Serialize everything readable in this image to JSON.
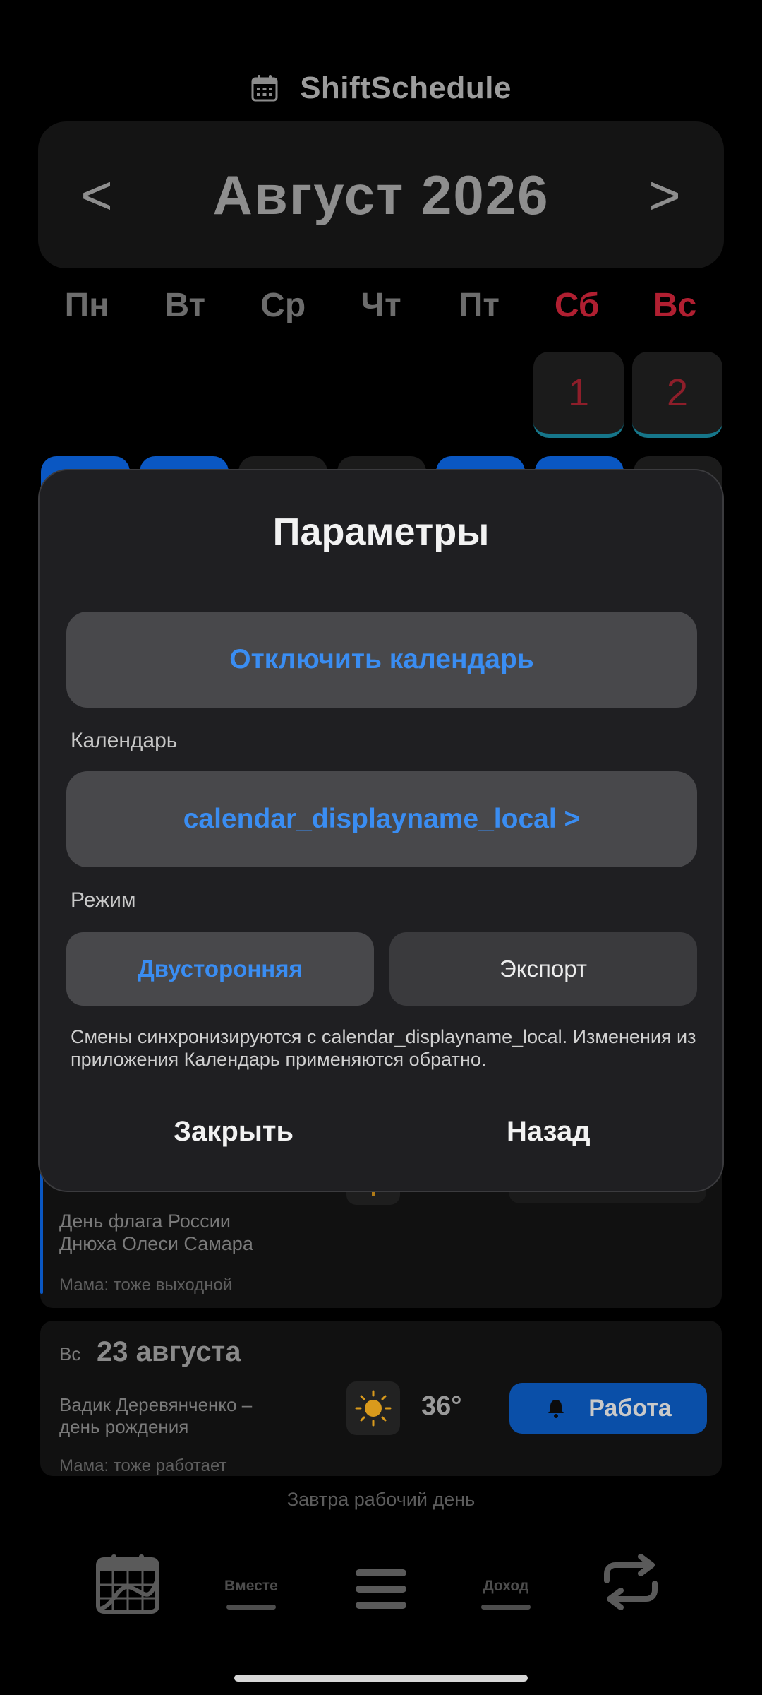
{
  "header": {
    "app_name": "ShiftSchedule"
  },
  "month_nav": {
    "prev": "<",
    "title": "Август 2026",
    "next": ">"
  },
  "weekdays": [
    "Пн",
    "Вт",
    "Ср",
    "Чт",
    "Пт",
    "Сб",
    "Вс"
  ],
  "calendar": {
    "day_1": "1",
    "day_2": "2"
  },
  "list": {
    "card1": {
      "holiday": "День флага России",
      "birthday": "Днюха Олеси Самара",
      "note": "Мама: тоже выходной"
    },
    "card2": {
      "weekday": "Вс",
      "date": "23 августа",
      "event": "Вадик Деревянченко –\nдень рождения",
      "temp": "36°",
      "shift_button": "Работа",
      "note": "Мама: тоже работает"
    }
  },
  "modal": {
    "title": "Параметры",
    "disable_button": "Отключить календарь",
    "calendar_label": "Календарь",
    "calendar_select": "calendar_displayname_local >",
    "mode_label": "Режим",
    "mode_two_way": "Двусторонняя",
    "mode_export": "Экспорт",
    "helper": "Смены синхронизируются с calendar_displayname_local. Изменения из приложения Календарь применяются обратно.",
    "close_button": "Закрыть",
    "back_button": "Назад"
  },
  "status": {
    "tomorrow": "Завтра рабочий день"
  },
  "bottom_nav": {
    "together": "Вместе",
    "income": "Доход"
  },
  "colors": {
    "accent_blue": "#3a8df2",
    "weekend_red": "#b01f31",
    "work_button": "#0a4fa8",
    "modal_bg": "#1f1f22",
    "pill_bg": "#48484b"
  }
}
